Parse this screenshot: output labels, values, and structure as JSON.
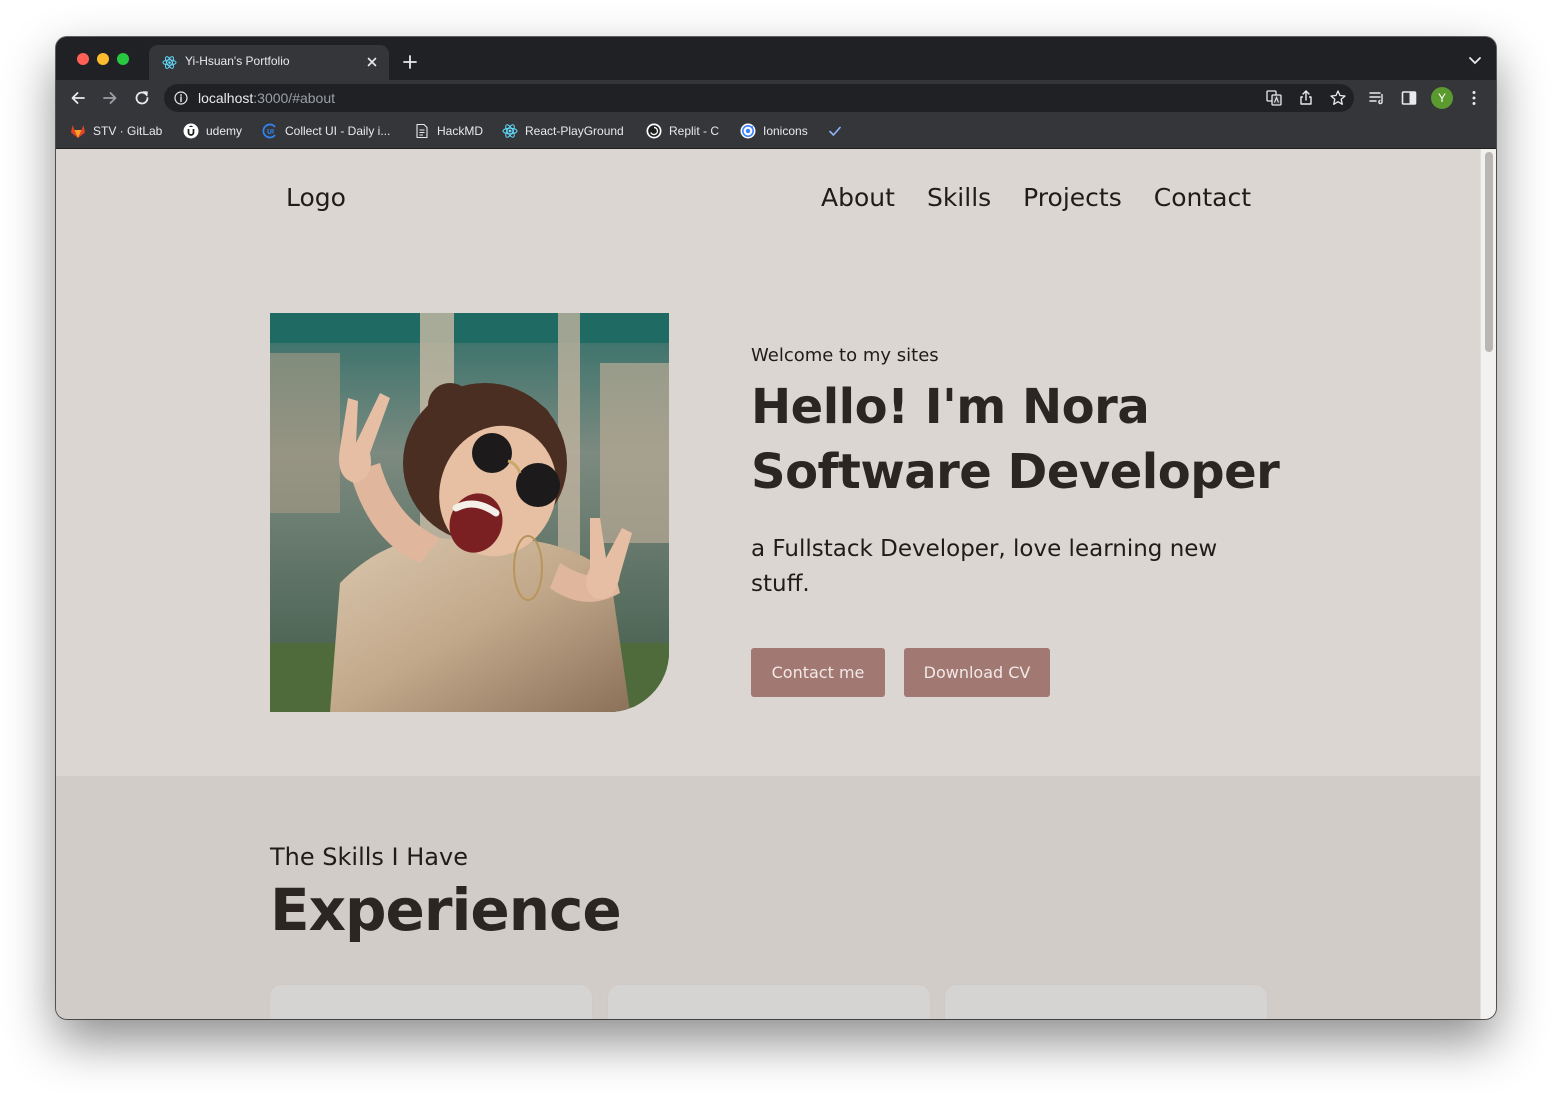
{
  "browser": {
    "tab": {
      "title": "Yi-Hsuan's Portfolio",
      "favicon": "react-icon"
    },
    "url": {
      "host": "localhost",
      "rest": ":3000/#about"
    },
    "profile_initial": "Y",
    "bookmarks": [
      {
        "label": "STV · GitLab",
        "icon": "gitlab-icon"
      },
      {
        "label": "udemy",
        "icon": "udemy-icon"
      },
      {
        "label": "Collect UI - Daily i...",
        "icon": "collectui-icon"
      },
      {
        "label": "HackMD",
        "icon": "document-icon"
      },
      {
        "label": "React-PlayGround",
        "icon": "react-icon"
      },
      {
        "label": "Replit - C",
        "icon": "replit-icon"
      },
      {
        "label": "Ionicons",
        "icon": "ionicons-icon"
      }
    ]
  },
  "site": {
    "logo": "Logo",
    "nav": [
      "About",
      "Skills",
      "Projects",
      "Contact"
    ],
    "hero": {
      "welcome": "Welcome to my sites",
      "title_line1": "Hello! I'm Nora",
      "title_line2": "Software Developer",
      "tagline": "a Fullstack Developer, love learning new stuff.",
      "contact_button": "Contact me",
      "cv_button": "Download CV"
    },
    "skills": {
      "subtitle": "The Skills I Have",
      "title": "Experience"
    }
  },
  "colors": {
    "hero_bg": "#dbd6d2",
    "skills_bg": "#d2ccc8",
    "button_bg": "#a27873",
    "heading_text": "#2b2523"
  }
}
